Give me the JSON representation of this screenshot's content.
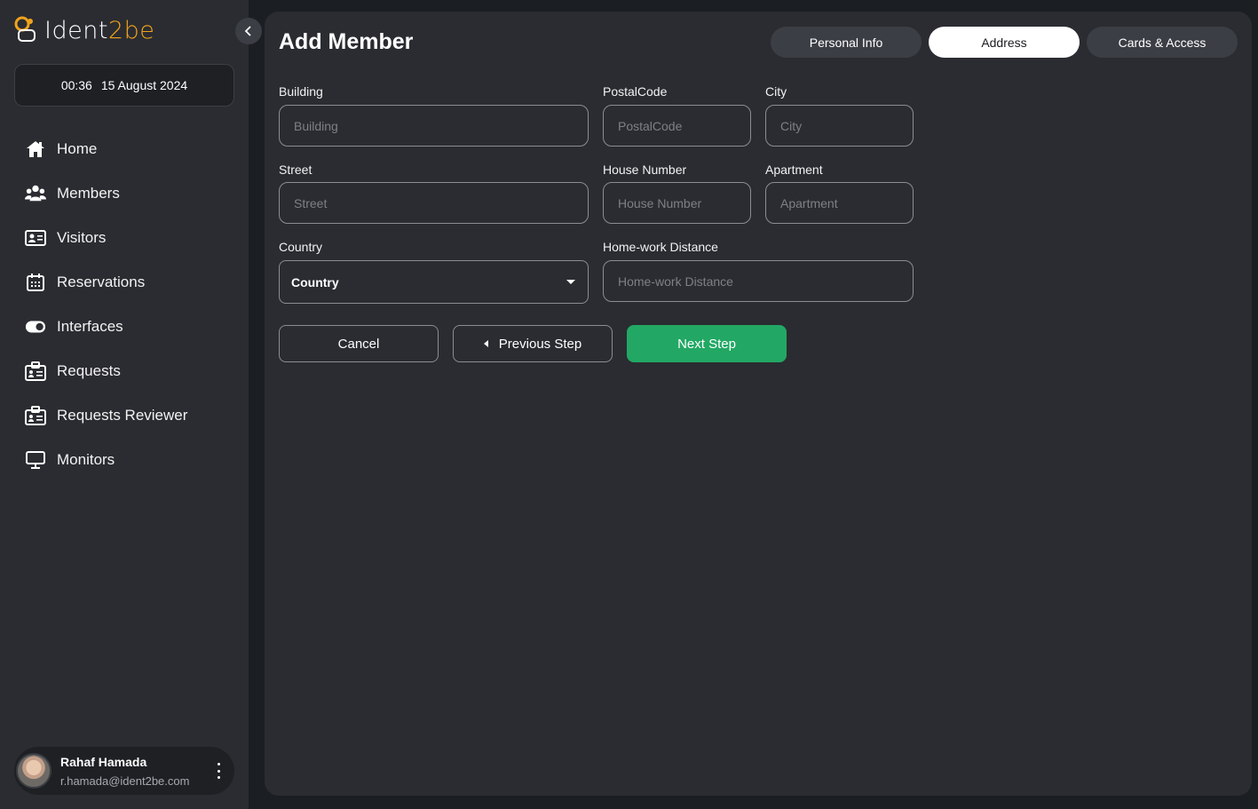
{
  "brand": {
    "name_part1": "Ident",
    "name_part2": "2be"
  },
  "datetime": {
    "time": "00:36",
    "date": "15 August 2024"
  },
  "sidebar": {
    "items": [
      {
        "label": "Home",
        "icon": "home-icon"
      },
      {
        "label": "Members",
        "icon": "members-icon"
      },
      {
        "label": "Visitors",
        "icon": "visitor-card-icon"
      },
      {
        "label": "Reservations",
        "icon": "calendar-icon"
      },
      {
        "label": "Interfaces",
        "icon": "toggle-icon"
      },
      {
        "label": "Requests",
        "icon": "id-badge-icon"
      },
      {
        "label": "Requests Reviewer",
        "icon": "id-badge-icon"
      },
      {
        "label": "Monitors",
        "icon": "monitor-icon"
      }
    ]
  },
  "user": {
    "name": "Rahaf Hamada",
    "email": "r.hamada@ident2be.com"
  },
  "page": {
    "title": "Add Member"
  },
  "tabs": [
    {
      "label": "Personal Info",
      "active": false
    },
    {
      "label": "Address",
      "active": true
    },
    {
      "label": "Cards & Access",
      "active": false
    }
  ],
  "form": {
    "building": {
      "label": "Building",
      "placeholder": "Building",
      "value": ""
    },
    "postal_code": {
      "label": "PostalCode",
      "placeholder": "PostalCode",
      "value": ""
    },
    "city": {
      "label": "City",
      "placeholder": "City",
      "value": ""
    },
    "street": {
      "label": "Street",
      "placeholder": "Street",
      "value": ""
    },
    "house_number": {
      "label": "House Number",
      "placeholder": "House Number",
      "value": ""
    },
    "apartment": {
      "label": "Apartment",
      "placeholder": "Apartment",
      "value": ""
    },
    "country": {
      "label": "Country",
      "selected": "Country"
    },
    "distance": {
      "label": "Home-work Distance",
      "placeholder": "Home-work Distance",
      "value": ""
    }
  },
  "actions": {
    "cancel": "Cancel",
    "previous": "Previous Step",
    "next": "Next Step"
  },
  "colors": {
    "accent_green": "#22a864",
    "brand_orange": "#f0a31c",
    "panel": "#2a2c31",
    "background": "#1b1e22"
  }
}
